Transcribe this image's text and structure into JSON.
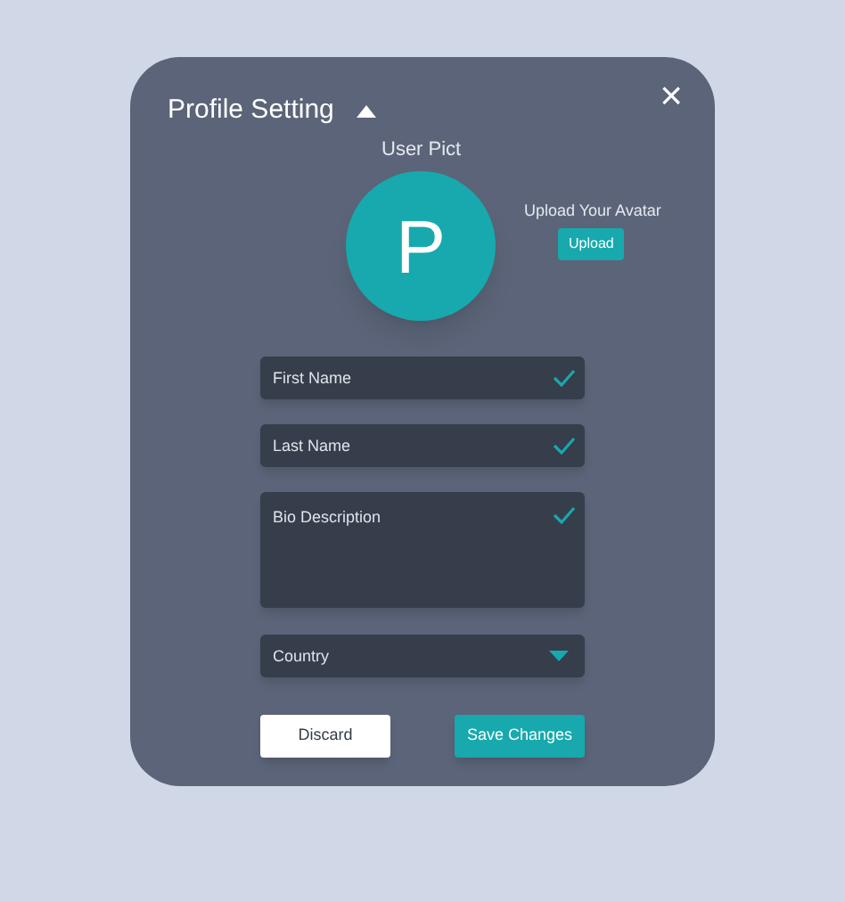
{
  "dialog": {
    "title": "Profile Setting",
    "expanded": true,
    "close": "×"
  },
  "avatar": {
    "label": "User Pict",
    "initial": "P",
    "upload_label": "Upload Your Avatar",
    "upload_button": "Upload"
  },
  "fields": [
    {
      "kind": "input",
      "placeholder": "First Name",
      "valid": true
    },
    {
      "kind": "input",
      "placeholder": "Last Name",
      "valid": true
    },
    {
      "kind": "textarea",
      "placeholder": "Bio Description",
      "valid": true
    },
    {
      "kind": "select",
      "placeholder": "Country"
    }
  ],
  "buttons": [
    {
      "label": "Discard",
      "kind": "secondary"
    },
    {
      "label": "Save Changes",
      "kind": "primary"
    }
  ]
}
